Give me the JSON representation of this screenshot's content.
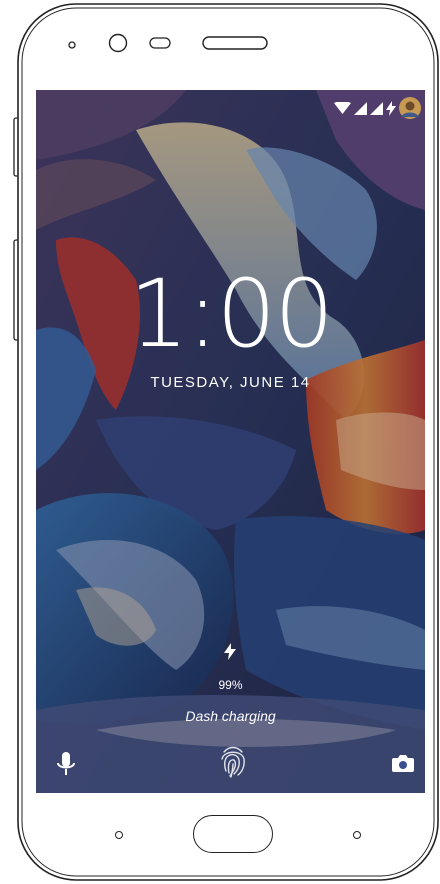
{
  "status_bar": {
    "icons": [
      "wifi-icon",
      "signal-icon",
      "signal-icon",
      "charging-bolt-icon",
      "avatar"
    ]
  },
  "lock_screen": {
    "time": "1:00",
    "date": "TUESDAY, JUNE 14",
    "battery_percent": "99%",
    "charging_status": "Dash charging"
  },
  "shortcuts": {
    "left": "mic-icon",
    "center": "fingerprint-icon",
    "right": "camera-icon"
  },
  "colors": {
    "text": "#ffffff",
    "device_outline": "#222222"
  }
}
